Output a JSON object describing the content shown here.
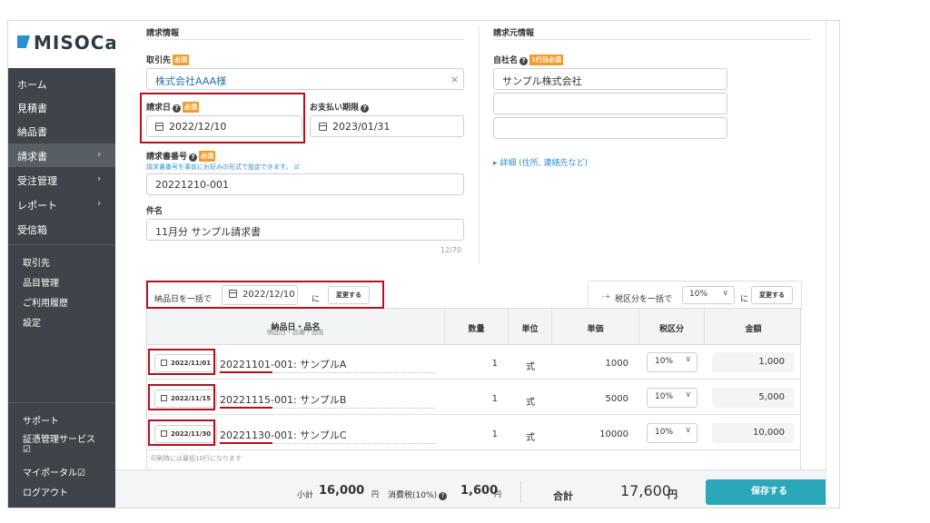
{
  "brand": {
    "logo_text": "MISOCa"
  },
  "sidebar": {
    "main_items": [
      {
        "label": "ホーム",
        "chevron": ""
      },
      {
        "label": "見積書",
        "chevron": ""
      },
      {
        "label": "納品書",
        "chevron": ""
      },
      {
        "label": "請求書",
        "chevron": "›"
      },
      {
        "label": "受注管理",
        "chevron": "›"
      },
      {
        "label": "レポート",
        "chevron": "›"
      },
      {
        "label": "受信箱",
        "chevron": ""
      }
    ],
    "active_item": "請求書",
    "sub_items": [
      "取引先",
      "品目管理",
      "ご利用履歴",
      "設定"
    ],
    "footer_items": [
      "サポート",
      "証憑管理サービス",
      "マイポータル",
      "ログアウト"
    ],
    "external_mark": "☑"
  },
  "invoice_info": {
    "section_title": "請求情報",
    "client": {
      "label": "取引先",
      "required": "必須",
      "value": "株式会社AAA様",
      "clear": "×"
    },
    "invoice_date": {
      "label": "請求日",
      "help": "?",
      "required": "必須",
      "value": "2022/12/10"
    },
    "due_date": {
      "label": "お支払い期限",
      "help": "?",
      "value": "2023/01/31"
    },
    "invoice_number": {
      "label": "請求書番号",
      "help": "?",
      "required": "必須",
      "hint": "請求書番号を事前にお好みの形式で設定できます。",
      "hint_icon": "☑",
      "value": "20221210-001"
    },
    "subject": {
      "label": "件名",
      "value": "11月分 サンプル請求書",
      "counter": "12/70"
    }
  },
  "issuer_info": {
    "section_title": "請求元情報",
    "company": {
      "label": "自社名",
      "help": "?",
      "required": "1行目必須",
      "value": "サンプル株式会社",
      "line2": "",
      "line3": ""
    },
    "detail_link": "▸ 詳細 (住所, 連絡先など)"
  },
  "bulk_toolbar": {
    "date_label": "納品日を一括で",
    "date_value": "2022/12/10",
    "date_suffix": "に",
    "date_button": "変更する",
    "tax_icon": "-+",
    "tax_label": "税区分を一括で",
    "tax_value": "10%",
    "tax_suffix": "に",
    "tax_button": "変更する",
    "chevron": "∨"
  },
  "table": {
    "headers": {
      "item": {
        "main": "納品日・品名",
        "sub": "納品日・品番・品名"
      },
      "qty": "数量",
      "unit": "単位",
      "price": "単価",
      "tax": "税区分",
      "amount": "金額"
    },
    "rows": [
      {
        "date": "2022/11/01",
        "code": "20221101",
        "name": "-001: サンプルA",
        "qty": "1",
        "unit": "式",
        "price": "1000",
        "tax": "10%",
        "amount": "1,000"
      },
      {
        "date": "2022/11/15",
        "code": "20221115",
        "name": "-001: サンプルB",
        "qty": "1",
        "unit": "式",
        "price": "5000",
        "tax": "10%",
        "amount": "5,000"
      },
      {
        "date": "2022/11/30",
        "code": "20221130",
        "name": "-001: サンプルC",
        "qty": "1",
        "unit": "式",
        "price": "10000",
        "tax": "10%",
        "amount": "10,000"
      }
    ],
    "chevron": "∨",
    "note": "印刷時には最低10行になります"
  },
  "totals": {
    "subtotal_label": "小計",
    "subtotal_value": "16,000",
    "tax_label": "消費税(10%)",
    "tax_help": "?",
    "tax_value": "1,600",
    "total_label": "合計",
    "total_value": "17,600",
    "unit": "円",
    "save_button": "保存する"
  }
}
